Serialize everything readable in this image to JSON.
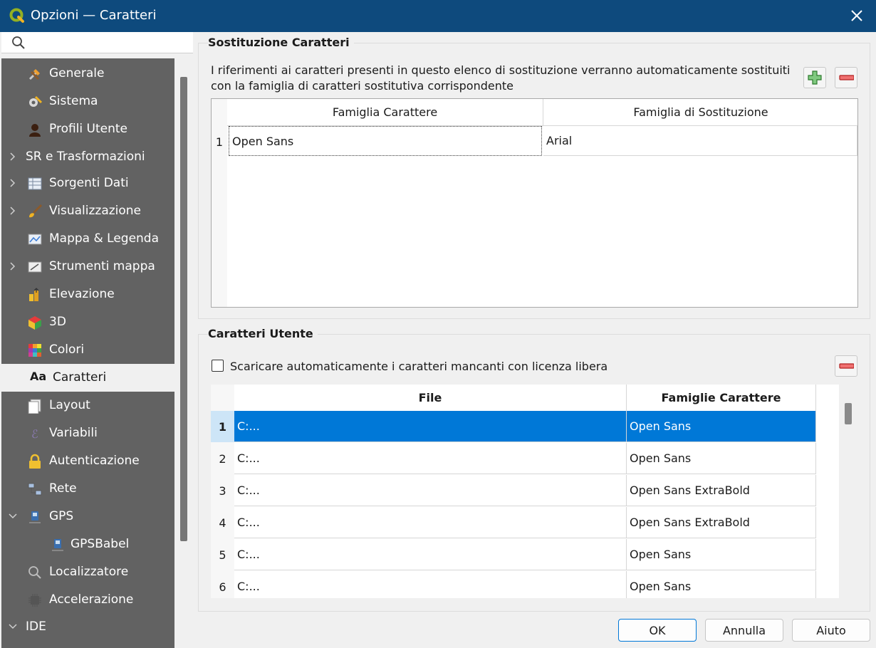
{
  "window": {
    "title": "Opzioni — Caratteri"
  },
  "search": {
    "placeholder": ""
  },
  "sidebar": {
    "items": [
      {
        "label": "Generale",
        "icon": "tools-icon"
      },
      {
        "label": "Sistema",
        "icon": "system-gear-icon"
      },
      {
        "label": "Profili Utente",
        "icon": "user-icon"
      },
      {
        "label": "SR e Trasformazioni",
        "icon": ""
      },
      {
        "label": "Sorgenti Dati",
        "icon": "table-icon"
      },
      {
        "label": "Visualizzazione",
        "icon": "brush-icon"
      },
      {
        "label": "Mappa & Legenda",
        "icon": "map-icon"
      },
      {
        "label": "Strumenti mappa",
        "icon": "map-tools-icon"
      },
      {
        "label": "Elevazione",
        "icon": "elevation-icon"
      },
      {
        "label": "3D",
        "icon": "cube-icon"
      },
      {
        "label": "Colori",
        "icon": "palette-icon"
      },
      {
        "label": "Caratteri",
        "icon": "font-aa-icon"
      },
      {
        "label": "Layout",
        "icon": "layout-icon"
      },
      {
        "label": "Variabili",
        "icon": "variable-icon"
      },
      {
        "label": "Autenticazione",
        "icon": "lock-icon"
      },
      {
        "label": "Rete",
        "icon": "network-icon"
      },
      {
        "label": "GPS",
        "icon": "gps-icon"
      },
      {
        "label": "GPSBabel",
        "icon": "gps-icon"
      },
      {
        "label": "Localizzatore",
        "icon": "search-icon"
      },
      {
        "label": "Accelerazione",
        "icon": "chip-icon"
      },
      {
        "label": "IDE",
        "icon": ""
      }
    ]
  },
  "substitution": {
    "title": "Sostituzione Caratteri",
    "description": "I riferimenti ai caratteri presenti in questo elenco di sostituzione verranno automaticamente sostituiti con la famiglia di caratteri sostitutiva corrispondente",
    "columns": [
      "Famiglia Carattere",
      "Famiglia di Sostituzione"
    ],
    "rows": [
      {
        "num": "1",
        "family": "Open Sans",
        "replacement": "Arial"
      }
    ]
  },
  "user_fonts": {
    "title": "Caratteri Utente",
    "auto_download_label": "Scaricare automaticamente i caratteri mancanti con licenza libera",
    "columns": [
      "File",
      "Famiglie Carattere"
    ],
    "rows": [
      {
        "num": "1",
        "file": "C:...",
        "family": "Open Sans"
      },
      {
        "num": "2",
        "file": "C:...",
        "family": "Open Sans"
      },
      {
        "num": "3",
        "file": "C:...",
        "family": "Open Sans ExtraBold"
      },
      {
        "num": "4",
        "file": "C:...",
        "family": "Open Sans ExtraBold"
      },
      {
        "num": "5",
        "file": "C:...",
        "family": "Open Sans"
      },
      {
        "num": "6",
        "file": "C:...",
        "family": "Open Sans"
      }
    ]
  },
  "buttons": {
    "ok": "OK",
    "cancel": "Annulla",
    "help": "Aiuto"
  },
  "colors": {
    "titlebar": "#0e4a7d",
    "sidebar": "#626262",
    "selection": "#0078d7",
    "add": "#3a9a3a",
    "remove": "#d9322f"
  }
}
